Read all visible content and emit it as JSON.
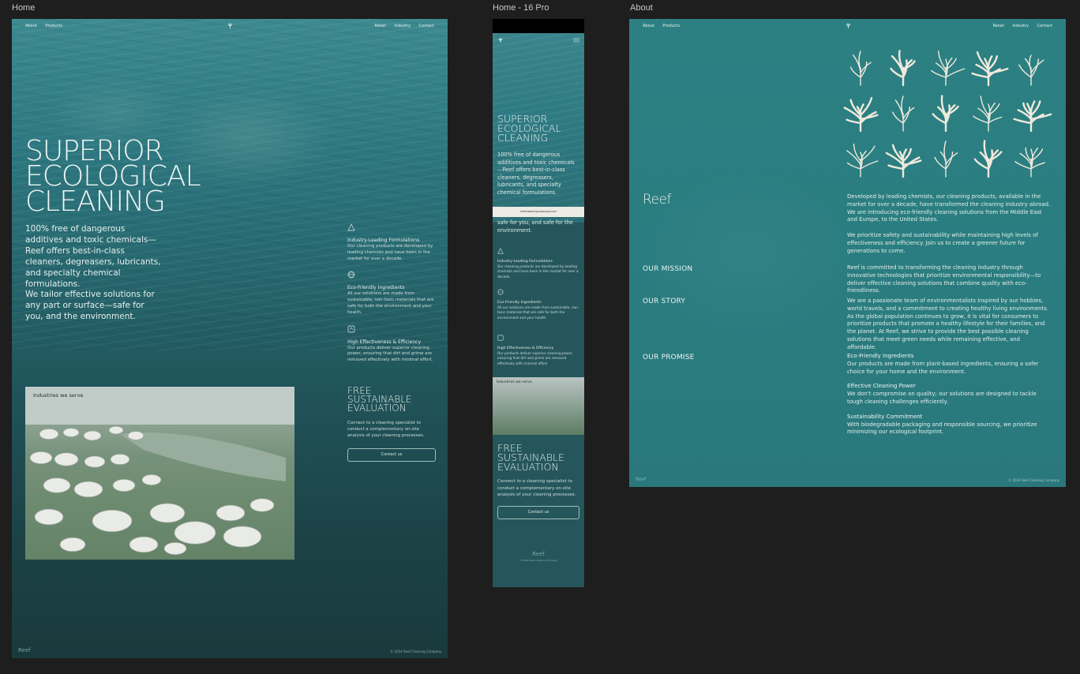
{
  "frames": {
    "home": "Home",
    "mobile": "Home - 16 Pro",
    "about": "About"
  },
  "nav": {
    "about": "About",
    "products": "Products",
    "retail": "Retail",
    "industry": "Industry",
    "contact": "Contact"
  },
  "hero": {
    "title_l1": "SUPERIOR",
    "title_l2": "ECOLOGICAL",
    "title_l3": "CLEANING",
    "p1": "100% free of dangerous additives and toxic chemicals—Reef offers best-in-class cleaners, degreasers, lubricants, and specialty chemical formulations.",
    "p2": "We tailor effective solutions for any part or surface—safe for you, and the environment."
  },
  "features": [
    {
      "title": "Industry-Leading Formulations",
      "desc": "Our cleaning products are developed by leading chemists and have been in the market for over a decade."
    },
    {
      "title": "Eco-Friendly Ingredients",
      "desc": "All our solutions are made from sustainable, non-toxic materials that are safe for both the environment and your health."
    },
    {
      "title": "High Effectiveness & Efficiency",
      "desc": "Our products deliver superior cleaning power, ensuring that dirt and grime are removed effectively with minimal effort."
    }
  ],
  "industries": {
    "label": "Industries we serve"
  },
  "cta": {
    "l1": "FREE",
    "l2": "SUSTAINABLE",
    "l3": "EVALUATION",
    "desc": "Connect to a cleaning specialist to conduct a complementary on-site analysis of your cleaning processes.",
    "button": "Contact us"
  },
  "footer": {
    "logo": "Reef",
    "copyright": "© 2024 Reef Cleaning Company"
  },
  "mobile": {
    "p1": "100% free of dangerous additives and toxic chemicals—Reef offers best-in-class cleaners, degreasers, lubricants, and specialty chemical formulations.",
    "p2": "safe for you, and safe for the environment.",
    "url": "reefcleaningcompany.com"
  },
  "about": {
    "logo": "Reef",
    "intro1": "Developed by leading chemists, our cleaning products, available in the market for over a decade, have transformed the cleaning industry abroad. We are introducing eco-friendly cleaning solutions from the Middle East and Europe, to the United States.",
    "intro2": "We prioritize safety and sustainability while maintaining high levels of effectiveness and efficiency. Join us to create a greener future for generations to come.",
    "mission_h": "OUR MISSION",
    "mission": "Reef is committed to transforming the cleaning industry through innovative technologies that prioritize environmental responsibility—to deliver effective cleaning solutions that combine quality with eco-friendliness.",
    "story_h": "OUR STORY",
    "story": "We are a passionate team of environmentalists inspired by our hobbies, world travels, and a commitment to creating healthy living environments. As the global population continues to grow, it is vital for consumers to prioritize products that promote a healthy lifestyle for their families, and the planet. At Reef, we strive to provide the best possible cleaning solutions that meet green needs while remaining effective, and affordable.",
    "promise_h": "OUR PROMISE",
    "promises": [
      {
        "title": "Eco-Friendly Ingredients",
        "desc": "Our products are made from plant-based ingredients, ensuring a safer choice for your home and the environment."
      },
      {
        "title": "Effective Cleaning Power",
        "desc": "We don't compromise on quality; our solutions are designed to tackle tough cleaning challenges efficiently."
      },
      {
        "title": "Sustainability Commitment",
        "desc": "With biodegradable packaging and responsible sourcing, we prioritize minimizing our ecological footprint."
      }
    ],
    "footer_logo": "Reef",
    "footer_copy": "© 2024 Reef Cleaning Company"
  },
  "colors": {
    "accent": "#2c8082",
    "coral": "#efe9dc",
    "canvas": "#1e1e1e"
  }
}
